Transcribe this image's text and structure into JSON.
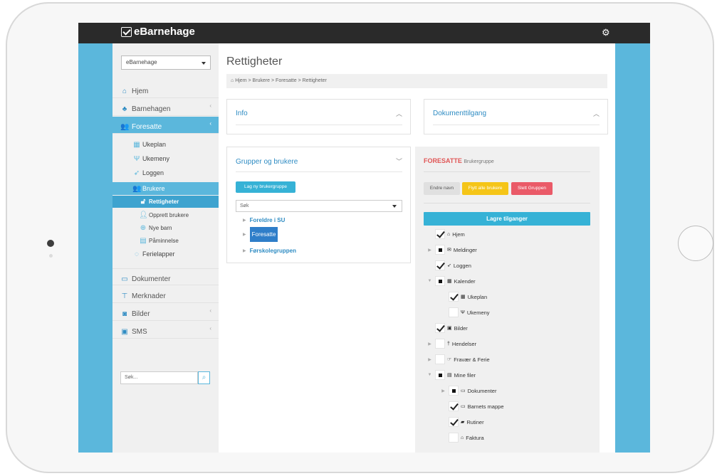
{
  "app": {
    "brand": "eBarnehage",
    "settings_icon": "gear-icon"
  },
  "sidebar": {
    "kindergarten_select": "eBarnehage",
    "items": [
      {
        "label": "Hjem",
        "icon": "home-icon"
      },
      {
        "label": "Barnehagen",
        "icon": "sitemap-icon"
      },
      {
        "label": "Foresatte",
        "icon": "users-icon"
      },
      {
        "label": "Dokumenter",
        "icon": "folder-icon"
      },
      {
        "label": "Merknader",
        "icon": "pin-icon"
      },
      {
        "label": "Bilder",
        "icon": "camera-icon"
      },
      {
        "label": "SMS",
        "icon": "sms-icon"
      }
    ],
    "sub_items": [
      {
        "label": "Ukeplan",
        "icon": "calendar-icon"
      },
      {
        "label": "Ukemeny",
        "icon": "cutlery-icon"
      },
      {
        "label": "Loggen",
        "icon": "paper-plane-icon"
      },
      {
        "label": "Brukere",
        "icon": "users-icon"
      },
      {
        "label": "Rettigheter",
        "icon": "unlock-icon"
      },
      {
        "label": "Opprett brukere",
        "icon": "user-add-icon"
      },
      {
        "label": "Nye barn",
        "icon": "plus-circle-icon"
      },
      {
        "label": "Påminnelse",
        "icon": "calendar-icon"
      },
      {
        "label": "Ferielapper",
        "icon": "spinner-icon"
      }
    ],
    "search_placeholder": "Søk..."
  },
  "main": {
    "title": "Rettigheter",
    "breadcrumb": [
      "Hjem",
      "Brukere",
      "Foresatte",
      "Rettigheter"
    ],
    "breadcrumb_sep": ">",
    "info_panel": {
      "title": "Info"
    },
    "doc_panel": {
      "title": "Dokumenttilgang"
    },
    "groups_panel": {
      "title": "Grupper og brukere",
      "new_group_button": "Lag ny brukergruppe",
      "search_placeholder": "Søk",
      "groups": [
        "Foreldre i SU",
        "Foresatte",
        "Førskolegruppen"
      ]
    },
    "permissions": {
      "group_name": "FORESATTE",
      "group_type": "Brukergruppe",
      "rename_button": "Endre navn",
      "move_all_button": "Flytt alle brukere",
      "delete_button": "Slett Gruppen",
      "save_button": "Lagre tilganger",
      "colors": {
        "rename": "#e0e0e0",
        "move": "#f5c518",
        "delete": "#ea5a68",
        "save": "#36b2d6"
      },
      "items": [
        {
          "label": "Hjem",
          "icon": "home-icon",
          "state": "checked"
        },
        {
          "label": "Meldinger",
          "icon": "envelope-icon",
          "state": "partial"
        },
        {
          "label": "Loggen",
          "icon": "paper-plane-icon",
          "state": "checked"
        },
        {
          "label": "Kalender",
          "icon": "calendar-icon",
          "state": "partial"
        },
        {
          "label": "Ukeplan",
          "icon": "calendar-icon",
          "state": "checked"
        },
        {
          "label": "Ukemeny",
          "icon": "cutlery-icon",
          "state": "unchecked"
        },
        {
          "label": "Bilder",
          "icon": "image-icon",
          "state": "checked"
        },
        {
          "label": "Hendelser",
          "icon": "pin-icon",
          "state": "unchecked"
        },
        {
          "label": "Fravær & Ferie",
          "icon": "hand-icon",
          "state": "unchecked"
        },
        {
          "label": "Mine filer",
          "icon": "file-icon",
          "state": "partial"
        },
        {
          "label": "Dokumenter",
          "icon": "folder-icon",
          "state": "partial"
        },
        {
          "label": "Barnets mappe",
          "icon": "folder-icon",
          "state": "checked"
        },
        {
          "label": "Rutiner",
          "icon": "book-icon",
          "state": "checked"
        },
        {
          "label": "Faktura",
          "icon": "bank-icon",
          "state": "unchecked"
        }
      ]
    }
  }
}
